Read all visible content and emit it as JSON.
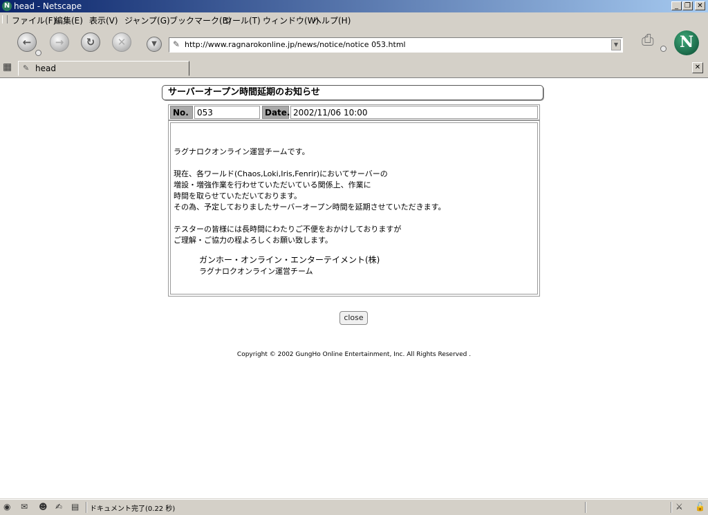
{
  "window": {
    "title": "head - Netscape",
    "controls": [
      "_",
      "❐",
      "✕"
    ]
  },
  "menu": [
    "ファイル(F)",
    "編集(E)",
    "表示(V)",
    "ジャンプ(G)",
    "ブックマーク(B)",
    "ツール(T)",
    "ウィンドウ(W)",
    "ヘルプ(H)"
  ],
  "toolbar": {
    "url": "http://www.ragnarokonline.jp/news/notice/notice 053.html",
    "logo": "N"
  },
  "tab": {
    "label": "head"
  },
  "notice": {
    "title": "サーバーオープン時間延期のお知らせ",
    "no_label": "No.",
    "no_value": "053",
    "date_label": "Date.",
    "date_value": "2002/11/06 10:00",
    "lines": [
      "ラグナロクオンライン運営チームです。",
      "",
      "現在、各ワールド(Chaos,Loki,Iris,Fenrir)においてサーバーの",
      "増設・増強作業を行わせていただいている関係上、作業に",
      "時間を取らせていただいております。",
      "その為、予定しておりましたサーバーオープン時間を延期させていただきます。",
      "",
      "テスターの皆様には長時間にわたりご不便をおかけしておりますが",
      "ご理解・ご協力の程よろしくお願い致します。"
    ],
    "signature_company": "ガンホー・オンライン・エンターテイメント(株)",
    "signature_team": "ラグナロクオンライン運営チーム",
    "close_label": "close",
    "copyright": "Copyright © 2002 GungHo Online Entertainment, Inc. All Rights Reserved ."
  },
  "status": {
    "text": "ドキュメント完了(0.22 秒)"
  }
}
